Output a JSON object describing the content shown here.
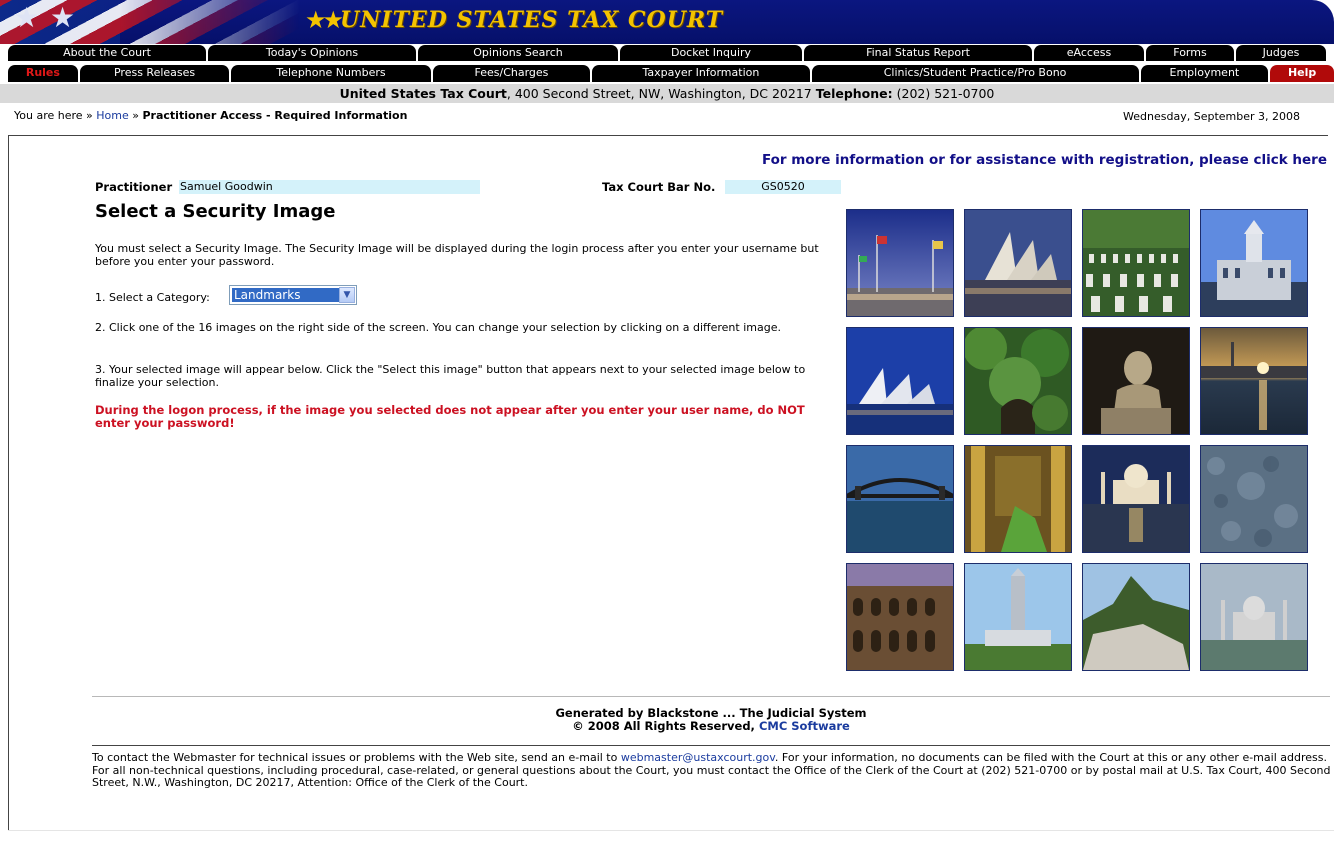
{
  "banner": {
    "title": "UNITED STATES TAX COURT"
  },
  "nav": {
    "row1": [
      "About the Court",
      "Today's Opinions",
      "Opinions Search",
      "Docket Inquiry",
      "Final Status Report",
      "eAccess",
      "Forms",
      "Judges"
    ],
    "row2": [
      "Rules",
      "Press Releases",
      "Telephone Numbers",
      "Fees/Charges",
      "Taxpayer Information",
      "Clinics/Student Practice/Pro Bono",
      "Employment",
      "Help"
    ]
  },
  "address_bar": {
    "court": "United States Tax Court",
    "address": ", 400 Second Street, NW, Washington, DC 20217 ",
    "phone_label": "Telephone:",
    "phone": " (202) 521-0700"
  },
  "breadcrumb": {
    "prefix": "You are here » ",
    "home": "Home",
    "sep": " » ",
    "current": "Practitioner Access - Required Information"
  },
  "date": "Wednesday, September 3, 2008",
  "help_link": "For more information or for assistance with registration, please click here",
  "practitioner": {
    "label": "Practitioner",
    "name": "Samuel Goodwin"
  },
  "bar_no": {
    "label": "Tax Court Bar No.",
    "value": "GS0520"
  },
  "page_title": "Select a Security Image",
  "instructions": {
    "intro": "You must select a Security Image. The Security Image will be displayed during the login process after you enter your username but before you enter your password.",
    "step1_label": "1. Select a Category:",
    "step2": "2. Click one of the 16 images on the right side of the screen. You can change your selection by clicking on a different image.",
    "step3": "3. Your selected image will appear below. Click the \"Select this image\" button that appears next to your selected image below to finalize your selection.",
    "warning": "During the logon process, if the image you selected does not appear after you enter your user name, do NOT enter your password!"
  },
  "category": {
    "selected": "Landmarks"
  },
  "images": [
    {
      "name": "flags-plaza"
    },
    {
      "name": "opera-house-dusk"
    },
    {
      "name": "cemetery-rows"
    },
    {
      "name": "capitol-building"
    },
    {
      "name": "opera-house-blue"
    },
    {
      "name": "jungle-ruins"
    },
    {
      "name": "lincoln-memorial"
    },
    {
      "name": "city-sunset"
    },
    {
      "name": "harbour-bridge"
    },
    {
      "name": "temple-interior"
    },
    {
      "name": "taj-mahal-reflection"
    },
    {
      "name": "stone-texture"
    },
    {
      "name": "colosseum"
    },
    {
      "name": "monument-tower"
    },
    {
      "name": "mountain-peak"
    },
    {
      "name": "taj-mahal-haze"
    }
  ],
  "footer": {
    "generated": "Generated by Blackstone ... The Judicial System",
    "copyright": "© 2008 All Rights Reserved, ",
    "company": "CMC Software",
    "contact_1": "To contact the Webmaster for technical issues or problems with the Web site, send an e-mail to ",
    "email": "webmaster@ustaxcourt.gov",
    "contact_2": ". For your information, no documents can be filed with the Court at this or any other e-mail address. For all non-technical questions, including procedural, case-related, or general questions about the Court, you must contact the Office of the Clerk of the Court at (202) 521-0700 or by postal mail at U.S. Tax Court, 400 Second Street, N.W., Washington, DC 20217, Attention: Office of the Clerk of the Court."
  },
  "colors": {
    "banner": "#0b1680",
    "logo": "#f3c300",
    "link": "#1a3b9e",
    "warning": "#cc1122",
    "field_bg": "#d4f2fa"
  }
}
